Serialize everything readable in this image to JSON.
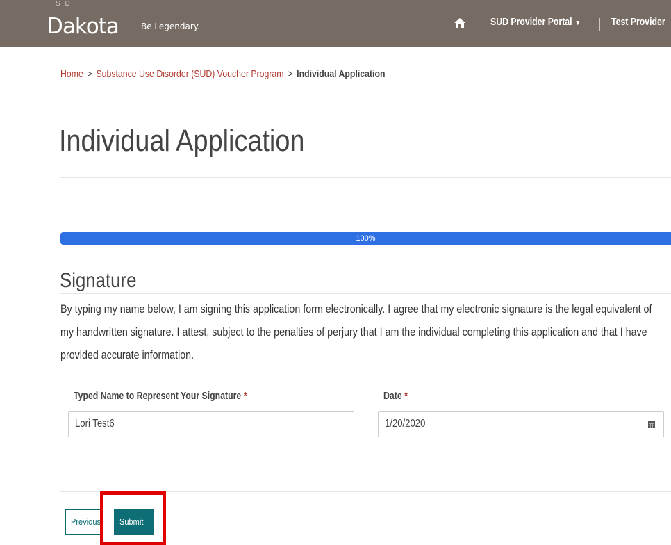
{
  "header": {
    "logo_small": "S D",
    "logo_main": "Dakota",
    "logo_tagline": "Be Legendary.",
    "nav": {
      "home_icon": "home-icon",
      "portal_label": "SUD Provider Portal",
      "portal_caret": "▾",
      "provider_label": "Test Provider"
    }
  },
  "breadcrumb": {
    "home": "Home",
    "program": "Substance Use Disorder (SUD) Voucher Program",
    "current": "Individual Application",
    "separator": ">"
  },
  "page_title": "Individual Application",
  "progress": {
    "value_percent": 100,
    "label": "100%",
    "color": "#2f6fe4"
  },
  "section": {
    "title": "Signature",
    "text": "By typing my name below, I am signing this application form electronically. I agree that my electronic signature is the legal equivalent of my handwritten signature. I attest, subject to the penalties of perjury that I am the individual completing this application and that I have provided accurate information."
  },
  "form": {
    "name_label": "Typed Name to Represent Your Signature",
    "name_value": "Lori Test6",
    "date_label": "Date",
    "date_value": "1/20/2020",
    "required_marker": "*",
    "calendar_icon": "calendar-icon"
  },
  "buttons": {
    "previous_label": "Previous",
    "submit_label": "Submit"
  },
  "colors": {
    "header_bg": "#776c63",
    "accent_teal": "#0e6e75",
    "link_red": "#b23a2f",
    "highlight_red": "#e00000"
  }
}
